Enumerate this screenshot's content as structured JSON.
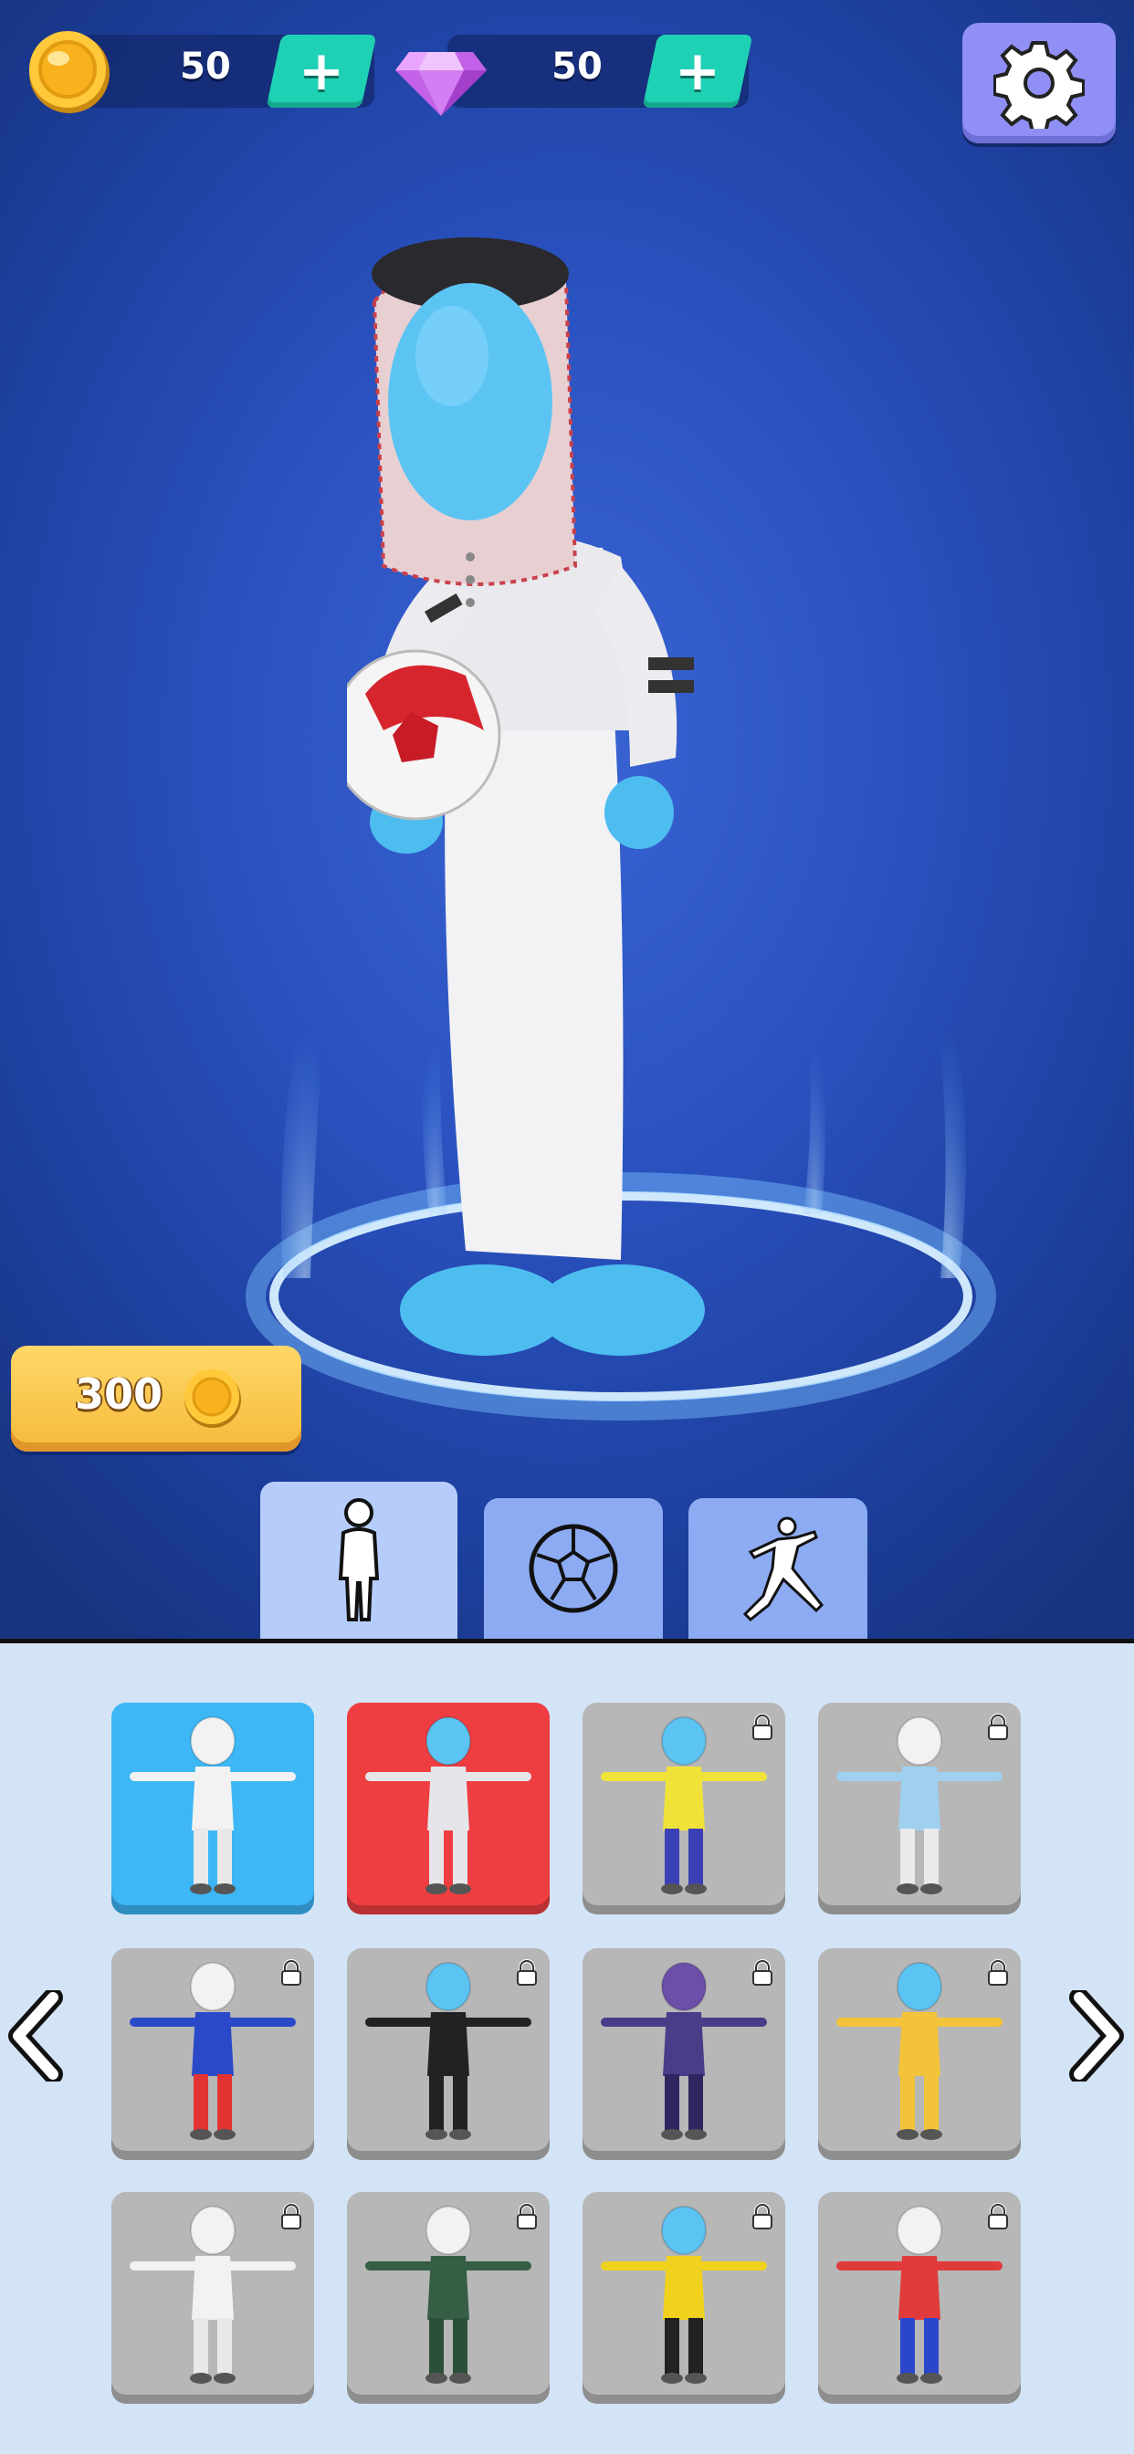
{
  "currencies": {
    "coins": {
      "value": "50",
      "icon": "coin-icon"
    },
    "gems": {
      "value": "50",
      "icon": "gem-icon"
    }
  },
  "settings": {
    "icon": "gear-icon"
  },
  "purchase": {
    "price": "300",
    "currency_icon": "coin-icon"
  },
  "tabs": [
    {
      "name": "tab-character",
      "icon": "person-icon",
      "active": true
    },
    {
      "name": "tab-ball",
      "icon": "soccer-ball-icon",
      "active": false
    },
    {
      "name": "tab-kick",
      "icon": "kick-pose-icon",
      "active": false
    }
  ],
  "skins": [
    {
      "id": "white-basic",
      "state": "owned",
      "bg": "#3db7f5",
      "locked": false
    },
    {
      "id": "thobe",
      "state": "selected",
      "bg": "#ee3e41",
      "locked": false
    },
    {
      "id": "yellow-kit",
      "state": "locked",
      "bg": "#b7b7b7",
      "locked": true
    },
    {
      "id": "sky-kit",
      "state": "locked",
      "bg": "#b7b7b7",
      "locked": true
    },
    {
      "id": "super-hero",
      "state": "locked",
      "bg": "#b7b7b7",
      "locked": true
    },
    {
      "id": "agent",
      "state": "locked",
      "bg": "#b7b7b7",
      "locked": true
    },
    {
      "id": "spiky-hair",
      "state": "locked",
      "bg": "#b7b7b7",
      "locked": true
    },
    {
      "id": "basketball",
      "state": "locked",
      "bg": "#b7b7b7",
      "locked": true
    },
    {
      "id": "king",
      "state": "locked",
      "bg": "#b7b7b7",
      "locked": true
    },
    {
      "id": "tracksuit",
      "state": "locked",
      "bg": "#b7b7b7",
      "locked": true
    },
    {
      "id": "striped-kit",
      "state": "locked",
      "bg": "#b7b7b7",
      "locked": true
    },
    {
      "id": "plumber",
      "state": "locked",
      "bg": "#b7b7b7",
      "locked": true
    }
  ],
  "colors": {
    "accent_teal": "#1fd1b4",
    "settings_purple": "#8f8ff5",
    "price_gold": "#f5bb3b",
    "panel_bg": "#d3e4f7"
  }
}
